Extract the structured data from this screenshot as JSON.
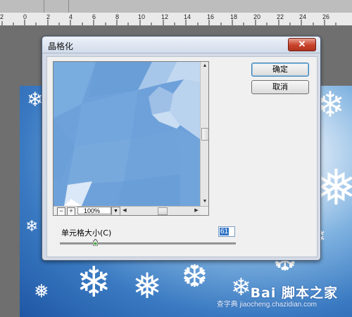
{
  "ruler": {
    "labels": [
      "2",
      "0",
      "2",
      "4",
      "6",
      "8",
      "10",
      "12",
      "14",
      "16",
      "18",
      "20",
      "22",
      "24",
      "26"
    ]
  },
  "dialog": {
    "title": "晶格化",
    "close_glyph": "✕",
    "ok_label": "确定",
    "cancel_label": "取消",
    "zoom_value": "100%",
    "zoom_minus": "−",
    "zoom_plus": "+",
    "cell_size_label": "单元格大小(C)",
    "cell_size_value": "61",
    "cell_size_slider_fraction": 0.2
  },
  "watermark": {
    "line1": "Bai 脚本之家",
    "line2": "查字典 jiaocheng.chazidian.com"
  },
  "colors": {
    "dialog_bg": "#d4dbe6",
    "close_red": "#c8412a",
    "preview_blue": "#6fa0d8",
    "input_selection": "#3174c6"
  },
  "icons": [
    "close-icon",
    "zoom-out-icon",
    "zoom-in-icon",
    "dropdown-arrow-icon",
    "scroll-up-icon",
    "scroll-down-icon",
    "scroll-left-icon",
    "scroll-right-icon",
    "slider-thumb-icon",
    "snowflake-icon"
  ]
}
